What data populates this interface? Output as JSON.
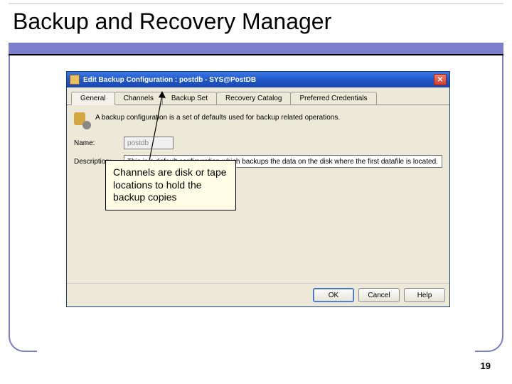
{
  "slide": {
    "title": "Backup and Recovery Manager",
    "page_number": "19"
  },
  "dialog": {
    "window_title": "Edit Backup Configuration : postdb - SYS@PostDB",
    "tabs": {
      "general": "General",
      "channels": "Channels",
      "backup_set": "Backup Set",
      "recovery_catalog": "Recovery Catalog",
      "preferred_credentials": "Preferred Credentials"
    },
    "info": "A backup configuration is a set of defaults used for backup related operations.",
    "labels": {
      "name": "Name:",
      "description": "Description:"
    },
    "fields": {
      "name_value": "postdb",
      "description_value": "This is a default configuration which backups the data on the disk where the first datafile is located."
    },
    "buttons": {
      "ok": "OK",
      "cancel": "Cancel",
      "help": "Help"
    }
  },
  "callout": {
    "text": "Channels are disk or tape locations to hold the backup copies"
  }
}
